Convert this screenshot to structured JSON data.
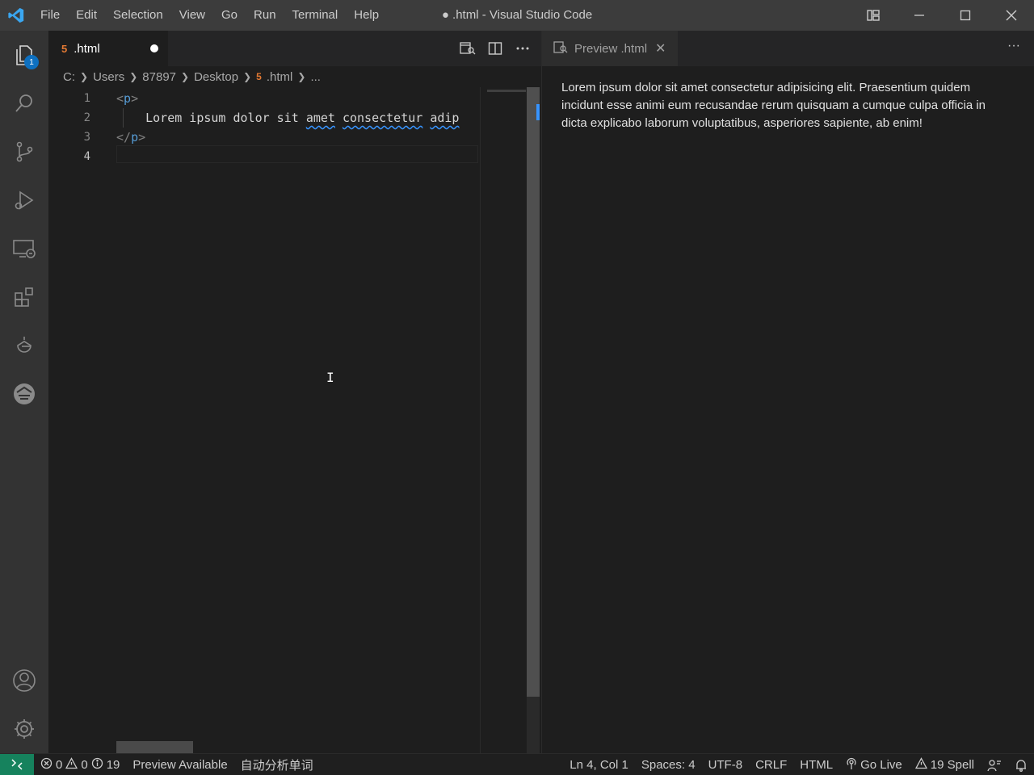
{
  "window": {
    "title": "● .html - Visual Studio Code"
  },
  "menu": [
    "File",
    "Edit",
    "Selection",
    "View",
    "Go",
    "Run",
    "Terminal",
    "Help"
  ],
  "activity": {
    "explorer_badge": "1",
    "items": [
      "explorer-icon",
      "search-icon",
      "source-control-icon",
      "run-debug-icon",
      "remote-explorer-icon",
      "extensions-icon",
      "timeline-icon",
      "live-share-icon",
      "accounts-icon",
      "settings-gear-icon"
    ]
  },
  "editor": {
    "tab": {
      "label": ".html",
      "icon": "5",
      "dirty": true
    },
    "breadcrumb": [
      "C:",
      "Users",
      "87897",
      "Desktop",
      ".html",
      "..."
    ],
    "line_numbers": [
      "1",
      "2",
      "3",
      "4"
    ],
    "active_line": 4,
    "code": {
      "open_tag_lt": "<",
      "open_tag_name": "p",
      "open_tag_gt": ">",
      "line2_plain": "    Lorem ipsum dolor sit ",
      "line2_spell1": "amet",
      "line2_space": " ",
      "line2_spell2": "consectetur",
      "line2_space2": " ",
      "line2_spell3": "adip",
      "close_tag_lt": "</",
      "close_tag_name": "p",
      "close_tag_gt": ">"
    },
    "text_cursor": "I"
  },
  "preview": {
    "tab_label": "Preview .html",
    "close_glyph": "✕",
    "more_glyph": "···",
    "body": "Lorem ipsum dolor sit amet consectetur adipisicing elit. Praesentium quidem incidunt esse animi eum recusandae rerum quisquam a cumque culpa officia in dicta explicabo laborum voluptatibus, asperiores sapiente, ab enim!"
  },
  "status": {
    "errors": "0",
    "warnings": "0",
    "infos": "19",
    "preview_available": "Preview Available",
    "auto_analyze": "自动分析单词",
    "position": "Ln 4, Col 1",
    "spaces": "Spaces: 4",
    "encoding": "UTF-8",
    "eol": "CRLF",
    "language": "HTML",
    "go_live": "Go Live",
    "spell": "19 Spell"
  },
  "colors": {
    "accent": "#0e70c0",
    "remote": "#16825d",
    "html_icon": "#e37933",
    "tag": "#569cd6"
  }
}
